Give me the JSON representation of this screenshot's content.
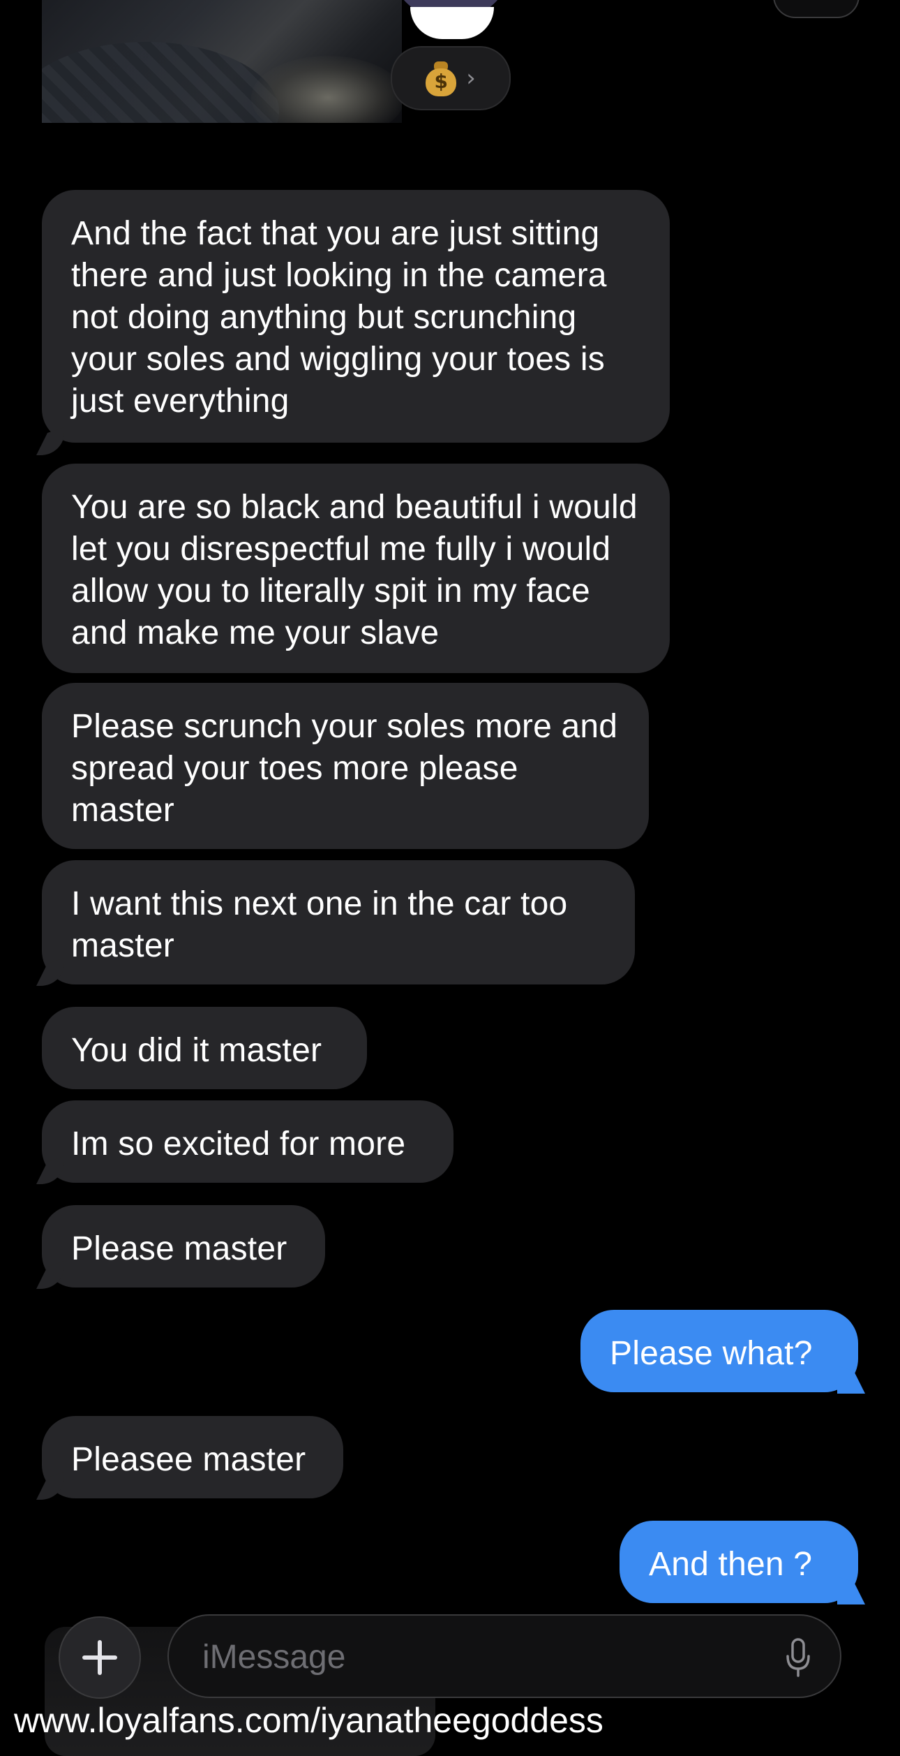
{
  "composer": {
    "placeholder": "iMessage"
  },
  "reactions": {
    "emoji_icon": "money-bag-icon"
  },
  "messages": [
    {
      "side": "in",
      "text": "And the fact that you are just sitting there and just looking in the camera not doing anything but scrunching your soles and wiggling your toes is just everything"
    },
    {
      "side": "in",
      "text": "You are so black and beautiful i would let you disrespectful me fully i would allow you to literally spit in my face and make me your slave"
    },
    {
      "side": "in",
      "text": "Please scrunch your soles more and spread your toes more please master"
    },
    {
      "side": "in",
      "text": "I want this next one in the car too master"
    },
    {
      "side": "in",
      "text": "You did it master"
    },
    {
      "side": "in",
      "text": "Im so excited for more"
    },
    {
      "side": "in",
      "text": "Please master"
    },
    {
      "side": "out",
      "text": "Please what?"
    },
    {
      "side": "in",
      "text": "Pleasee master"
    },
    {
      "side": "out",
      "text": "And then ?"
    }
  ],
  "watermark": "www.loyalfans.com/iyanatheegoddess",
  "colors": {
    "background": "#000000",
    "incoming_bubble": "#262629",
    "outgoing_bubble": "#3b8bf2"
  }
}
